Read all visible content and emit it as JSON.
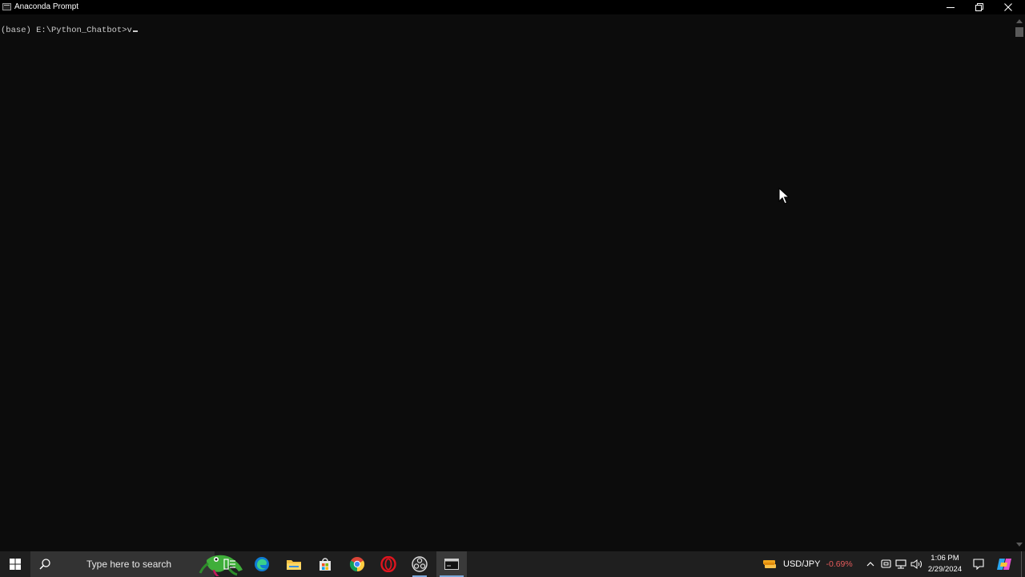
{
  "window": {
    "title": "Anaconda Prompt",
    "controls": {
      "minimize_icon": "minimize-icon",
      "maximize_icon": "restore-icon",
      "close_icon": "close-icon"
    }
  },
  "console": {
    "prompt": "(base) E:\\Python_Chatbot>",
    "typed_input": "v"
  },
  "taskbar": {
    "search_placeholder": "Type here to search",
    "pinned": [
      {
        "name": "task-view",
        "icon": "task-view-icon"
      },
      {
        "name": "edge",
        "icon": "edge-icon"
      },
      {
        "name": "file-explorer",
        "icon": "folder-icon"
      },
      {
        "name": "microsoft-store",
        "icon": "store-icon"
      },
      {
        "name": "chrome",
        "icon": "chrome-icon"
      },
      {
        "name": "opera",
        "icon": "opera-icon"
      },
      {
        "name": "obs",
        "icon": "obs-icon"
      },
      {
        "name": "anaconda-prompt",
        "icon": "terminal-icon"
      }
    ],
    "ticker": {
      "symbol": "USD/JPY",
      "change": "-0.69%",
      "change_color": "#e55b5b"
    },
    "clock": {
      "time": "1:06 PM",
      "date": "2/29/2024"
    }
  },
  "colors": {
    "console_bg": "#0c0c0c",
    "console_text": "#cccccc",
    "taskbar_bg": "#1f1f1f",
    "accent": "#7aa7d9"
  }
}
